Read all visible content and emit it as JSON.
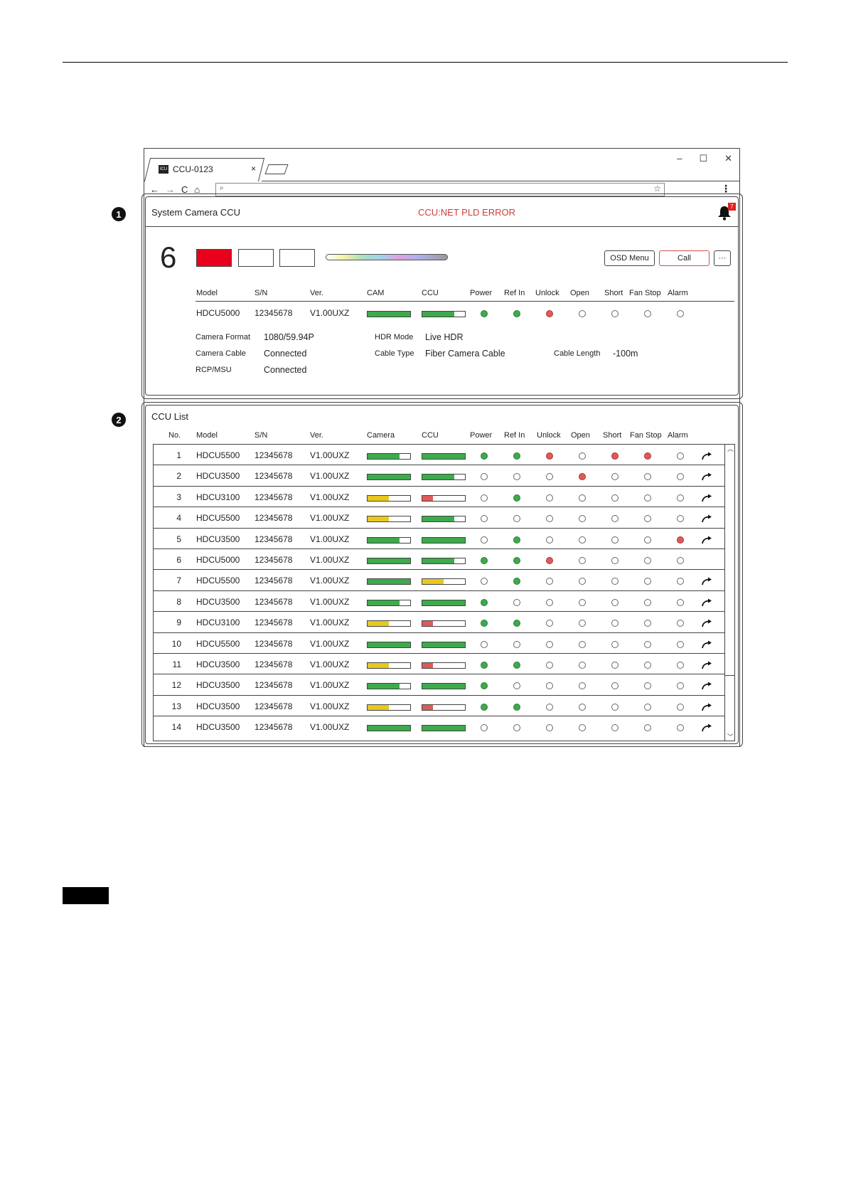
{
  "browser": {
    "tab_title": "CCU-0123",
    "favicon_text": "ICU",
    "tab_close": "×",
    "controls": {
      "minimize": "–",
      "maximize": "☐",
      "close": "✕"
    },
    "nav": {
      "back": "←",
      "forward": "→",
      "reload": "C",
      "home": "⌂"
    },
    "address_icon": "⌕",
    "bookmark": "☆",
    "menu": "⋮"
  },
  "callouts": [
    "1",
    "2"
  ],
  "header": {
    "title": "System Camera CCU",
    "error": "CCU:NET PLD ERROR",
    "notification_count": "7"
  },
  "detail": {
    "number": "6",
    "status_boxes": [
      "#e8001c",
      "#ffffff",
      "#ffffff"
    ],
    "osd_button": "OSD Menu",
    "call_button": "Call",
    "more_button": "···",
    "columns": [
      "Model",
      "S/N",
      "Ver.",
      "CAM",
      "CCU",
      "Power",
      "Ref In",
      "Unlock",
      "Open",
      "Short",
      "Fan Stop",
      "Alarm"
    ],
    "row": {
      "model": "HDCU5000",
      "sn": "12345678",
      "ver": "V1.00UXZ",
      "cam": {
        "level": 1.0,
        "color": "green"
      },
      "ccu": {
        "level": 0.75,
        "color": "green"
      },
      "status": [
        "green",
        "green",
        "red",
        "off",
        "off",
        "off",
        "off"
      ]
    },
    "info": {
      "camera_format_label": "Camera Format",
      "camera_format": "1080/59.94P",
      "hdr_mode_label": "HDR Mode",
      "hdr_mode": "Live HDR",
      "camera_cable_label": "Camera Cable",
      "camera_cable": "Connected",
      "cable_type_label": "Cable Type",
      "cable_type": "Fiber Camera Cable",
      "cable_length_label": "Cable Length",
      "cable_length": "-100m",
      "rcp_label": "RCP/MSU",
      "rcp": "Connected"
    }
  },
  "list": {
    "title": "CCU List",
    "columns": [
      "No.",
      "Model",
      "S/N",
      "Ver.",
      "Camera",
      "CCU",
      "Power",
      "Ref In",
      "Unlock",
      "Open",
      "Short",
      "Fan Stop",
      "Alarm"
    ],
    "colors": {
      "green": "#3daa4c",
      "yellow": "#e8c81e",
      "red": "#e05a5a"
    },
    "rows": [
      {
        "no": "1",
        "model": "HDCU5500",
        "sn": "12345678",
        "ver": "V1.00UXZ",
        "cam": [
          0.75,
          "green"
        ],
        "ccu": [
          1.0,
          "green"
        ],
        "status": [
          "green",
          "green",
          "red",
          "off",
          "red",
          "red",
          "off"
        ],
        "share": true
      },
      {
        "no": "2",
        "model": "HDCU3500",
        "sn": "12345678",
        "ver": "V1.00UXZ",
        "cam": [
          1.0,
          "green"
        ],
        "ccu": [
          0.75,
          "green"
        ],
        "status": [
          "off",
          "off",
          "off",
          "red",
          "off",
          "off",
          "off"
        ],
        "share": true
      },
      {
        "no": "3",
        "model": "HDCU3100",
        "sn": "12345678",
        "ver": "V1.00UXZ",
        "cam": [
          0.5,
          "yellow"
        ],
        "ccu": [
          0.25,
          "red"
        ],
        "status": [
          "off",
          "green",
          "off",
          "off",
          "off",
          "off",
          "off"
        ],
        "share": true
      },
      {
        "no": "4",
        "model": "HDCU5500",
        "sn": "12345678",
        "ver": "V1.00UXZ",
        "cam": [
          0.5,
          "yellow"
        ],
        "ccu": [
          0.75,
          "green"
        ],
        "status": [
          "off",
          "off",
          "off",
          "off",
          "off",
          "off",
          "off"
        ],
        "share": true
      },
      {
        "no": "5",
        "model": "HDCU3500",
        "sn": "12345678",
        "ver": "V1.00UXZ",
        "cam": [
          0.75,
          "green"
        ],
        "ccu": [
          1.0,
          "green"
        ],
        "status": [
          "off",
          "green",
          "off",
          "off",
          "off",
          "off",
          "red"
        ],
        "share": true
      },
      {
        "no": "6",
        "model": "HDCU5000",
        "sn": "12345678",
        "ver": "V1.00UXZ",
        "cam": [
          1.0,
          "green"
        ],
        "ccu": [
          0.75,
          "green"
        ],
        "status": [
          "green",
          "green",
          "red",
          "off",
          "off",
          "off",
          "off"
        ],
        "share": false
      },
      {
        "no": "7",
        "model": "HDCU5500",
        "sn": "12345678",
        "ver": "V1.00UXZ",
        "cam": [
          1.0,
          "green"
        ],
        "ccu": [
          0.5,
          "yellow"
        ],
        "status": [
          "off",
          "green",
          "off",
          "off",
          "off",
          "off",
          "off"
        ],
        "share": true
      },
      {
        "no": "8",
        "model": "HDCU3500",
        "sn": "12345678",
        "ver": "V1.00UXZ",
        "cam": [
          0.75,
          "green"
        ],
        "ccu": [
          1.0,
          "green"
        ],
        "status": [
          "green",
          "off",
          "off",
          "off",
          "off",
          "off",
          "off"
        ],
        "share": true
      },
      {
        "no": "9",
        "model": "HDCU3100",
        "sn": "12345678",
        "ver": "V1.00UXZ",
        "cam": [
          0.5,
          "yellow"
        ],
        "ccu": [
          0.25,
          "red"
        ],
        "status": [
          "green",
          "green",
          "off",
          "off",
          "off",
          "off",
          "off"
        ],
        "share": true
      },
      {
        "no": "10",
        "model": "HDCU5500",
        "sn": "12345678",
        "ver": "V1.00UXZ",
        "cam": [
          1.0,
          "green"
        ],
        "ccu": [
          1.0,
          "green"
        ],
        "status": [
          "off",
          "off",
          "off",
          "off",
          "off",
          "off",
          "off"
        ],
        "share": true
      },
      {
        "no": "11",
        "model": "HDCU3500",
        "sn": "12345678",
        "ver": "V1.00UXZ",
        "cam": [
          0.5,
          "yellow"
        ],
        "ccu": [
          0.25,
          "red"
        ],
        "status": [
          "green",
          "green",
          "off",
          "off",
          "off",
          "off",
          "off"
        ],
        "share": true
      },
      {
        "no": "12",
        "model": "HDCU3500",
        "sn": "12345678",
        "ver": "V1.00UXZ",
        "cam": [
          0.75,
          "green"
        ],
        "ccu": [
          1.0,
          "green"
        ],
        "status": [
          "green",
          "off",
          "off",
          "off",
          "off",
          "off",
          "off"
        ],
        "share": true
      },
      {
        "no": "13",
        "model": "HDCU3500",
        "sn": "12345678",
        "ver": "V1.00UXZ",
        "cam": [
          0.5,
          "yellow"
        ],
        "ccu": [
          0.25,
          "red"
        ],
        "status": [
          "green",
          "green",
          "off",
          "off",
          "off",
          "off",
          "off"
        ],
        "share": true
      },
      {
        "no": "14",
        "model": "HDCU3500",
        "sn": "12345678",
        "ver": "V1.00UXZ",
        "cam": [
          1.0,
          "green"
        ],
        "ccu": [
          1.0,
          "green"
        ],
        "status": [
          "off",
          "off",
          "off",
          "off",
          "off",
          "off",
          "off"
        ],
        "share": true
      }
    ]
  }
}
